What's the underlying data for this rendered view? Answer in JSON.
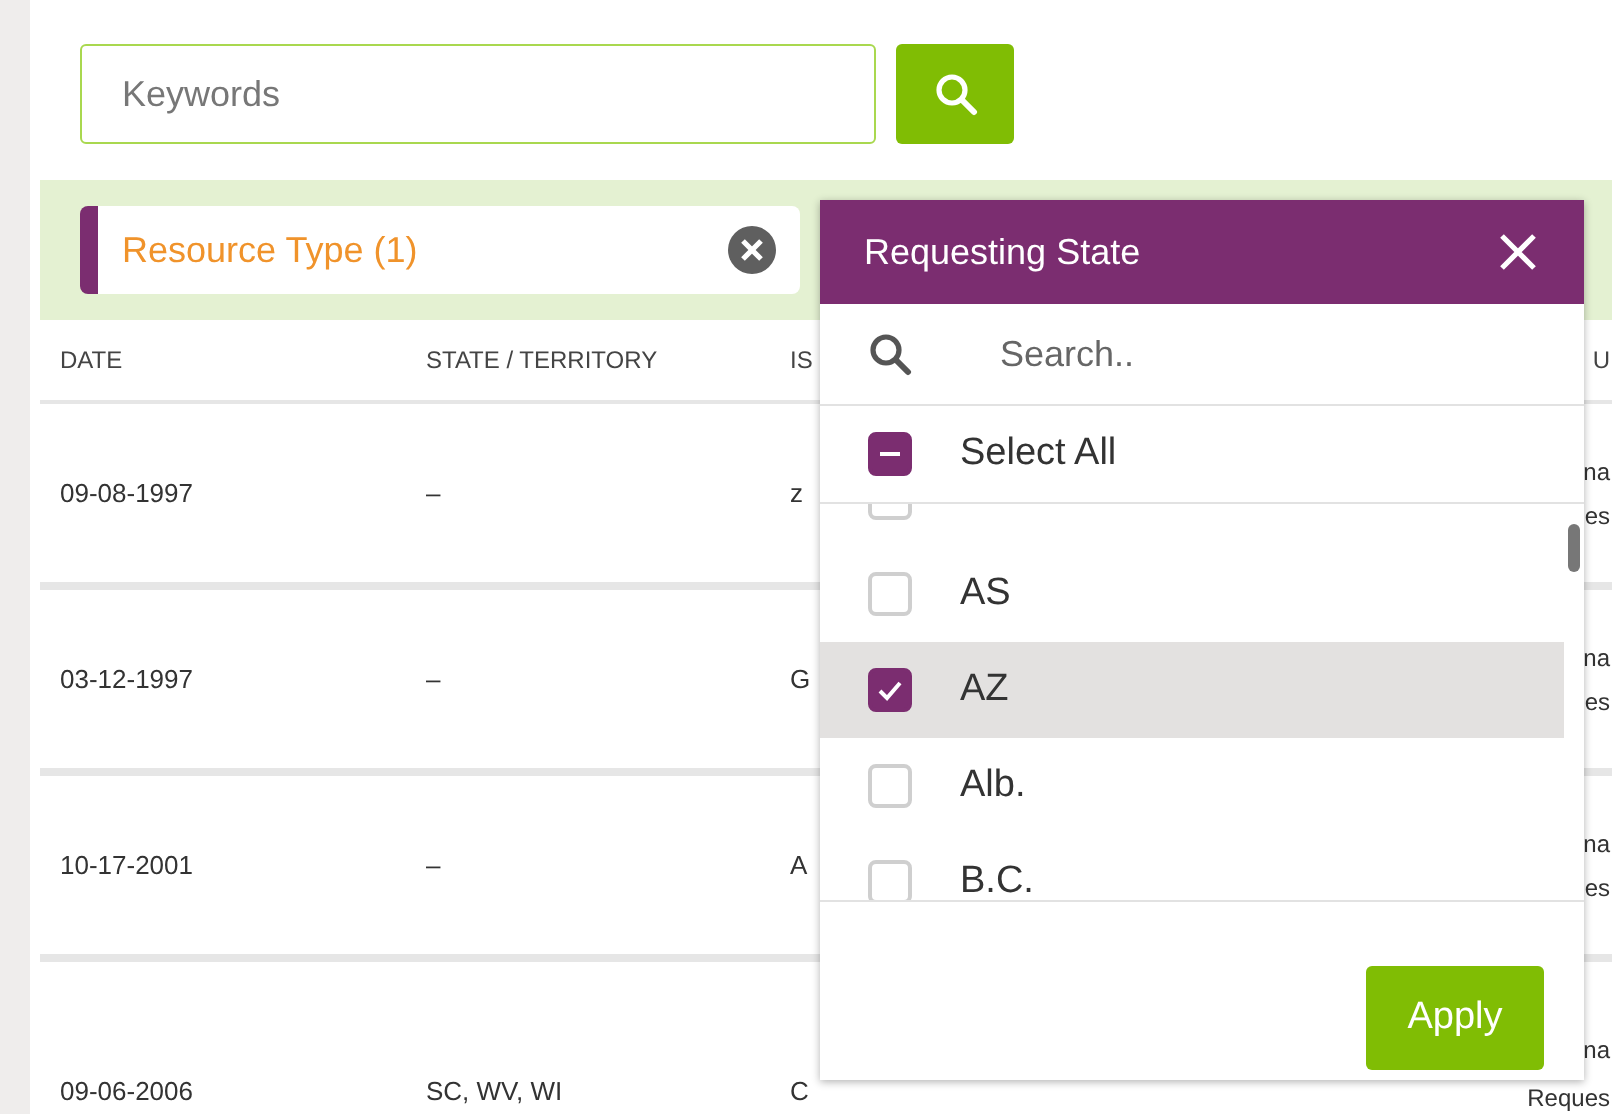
{
  "search": {
    "placeholder": "Keywords"
  },
  "filters": [
    {
      "label": "Resource Type (1)"
    }
  ],
  "table": {
    "columns": [
      "DATE",
      "STATE / TERRITORY",
      "IS",
      "U"
    ],
    "rows": [
      {
        "date": "09-08-1997",
        "state": "–",
        "column_3": "z",
        "column_5": [
          "na",
          "es"
        ]
      },
      {
        "date": "03-12-1997",
        "state": "–",
        "column_3": "G",
        "column_5": [
          "na",
          "es"
        ]
      },
      {
        "date": "10-17-2001",
        "state": "–",
        "column_3": "A",
        "column_5": [
          "na",
          "es"
        ]
      },
      {
        "date": "09-06-2006",
        "state": "SC, WV, WI",
        "column_3": "C",
        "column_5": [
          "na",
          "Reques"
        ]
      }
    ]
  },
  "popover": {
    "title": "Requesting State",
    "search_placeholder": "Search..",
    "select_all": {
      "label": "Select All",
      "checked": false,
      "indeterminate": true
    },
    "items": [
      {
        "checked": false,
        "selected": false
      },
      {
        "label": "AS",
        "checked": false,
        "selected": false
      },
      {
        "label": "AZ",
        "checked": true,
        "selected": true
      },
      {
        "label": "Alb.",
        "checked": false,
        "selected": false
      },
      {
        "label": "B.C.",
        "checked": false,
        "selected": false
      }
    ],
    "apply": "Apply"
  }
}
